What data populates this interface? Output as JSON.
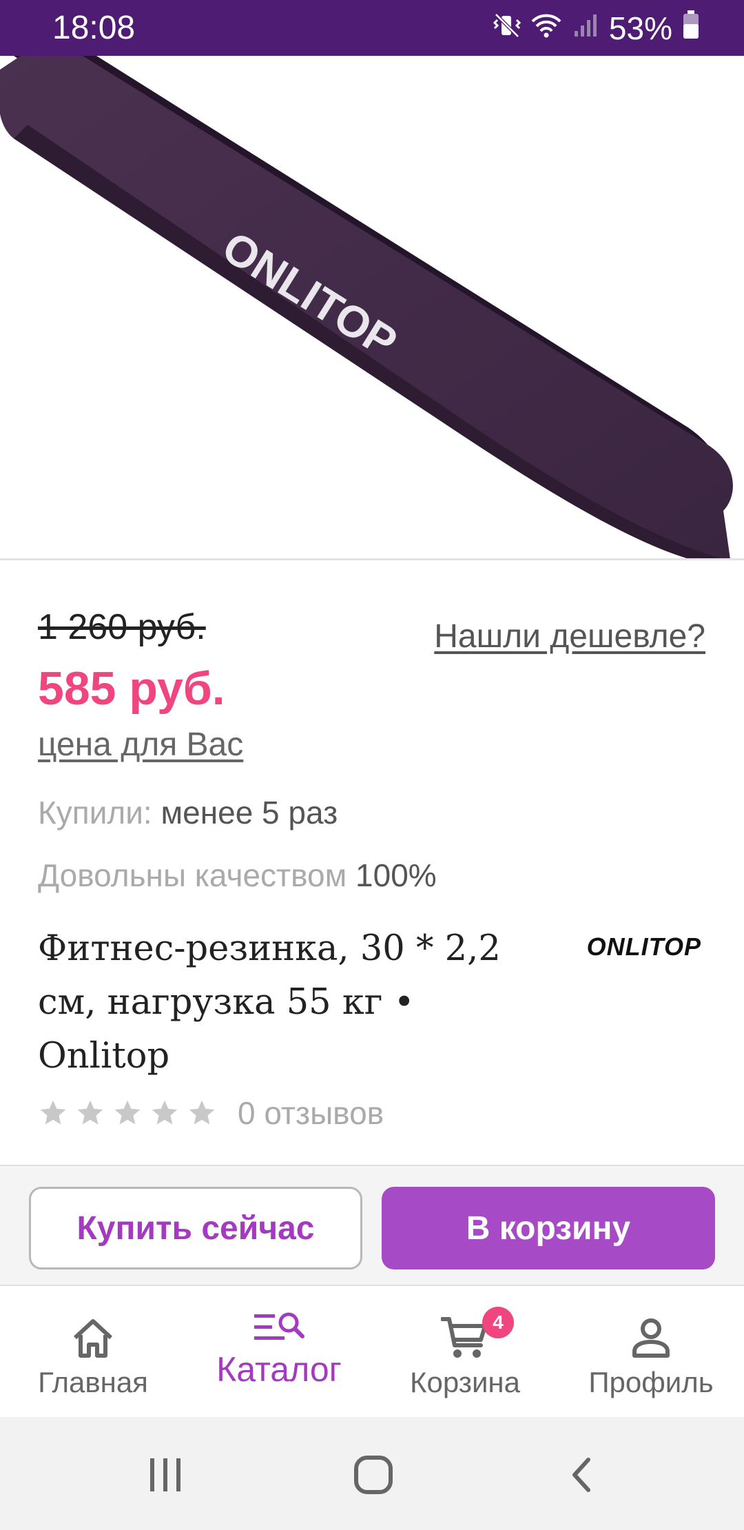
{
  "status_bar": {
    "time": "18:08",
    "battery_percent": "53%",
    "icons": [
      "mute-vibrate-icon",
      "wifi-icon",
      "cellular-signal-icon",
      "battery-icon"
    ]
  },
  "product_image": {
    "brand_text": "ONLITOP",
    "band_color": "#3b2340"
  },
  "price": {
    "old_price": "1 260 руб.",
    "new_price": "585 руб.",
    "price_for_you_link": "цена для Вас",
    "found_cheaper_link": "Нашли дешевле?"
  },
  "stats": {
    "bought_label": "Купили:",
    "bought_value": "менее 5 раз",
    "quality_label": "Довольны качеством",
    "quality_value": "100%"
  },
  "product": {
    "title": "Фитнес-резинка, 30 * 2,2 см, нагрузка 55 кг • Onlitop",
    "brand_logo_text": "ONLITOP",
    "rating_stars": 0,
    "reviews_text": "0 отзывов"
  },
  "actions": {
    "buy_now_label": "Купить сейчас",
    "add_to_cart_label": "В корзину"
  },
  "bottom_nav": {
    "items": [
      {
        "label": "Главная",
        "icon": "home-icon",
        "active": false
      },
      {
        "label": "Каталог",
        "icon": "catalog-search-icon",
        "active": true
      },
      {
        "label": "Корзина",
        "icon": "cart-icon",
        "active": false,
        "badge": "4"
      },
      {
        "label": "Профиль",
        "icon": "profile-icon",
        "active": false
      }
    ]
  },
  "system_nav": {
    "icons": [
      "recent-apps-icon",
      "home-circle-icon",
      "back-icon"
    ]
  },
  "colors": {
    "status_bar": "#4f1c74",
    "accent_purple": "#a64ac6",
    "price_pink": "#f0467f"
  }
}
